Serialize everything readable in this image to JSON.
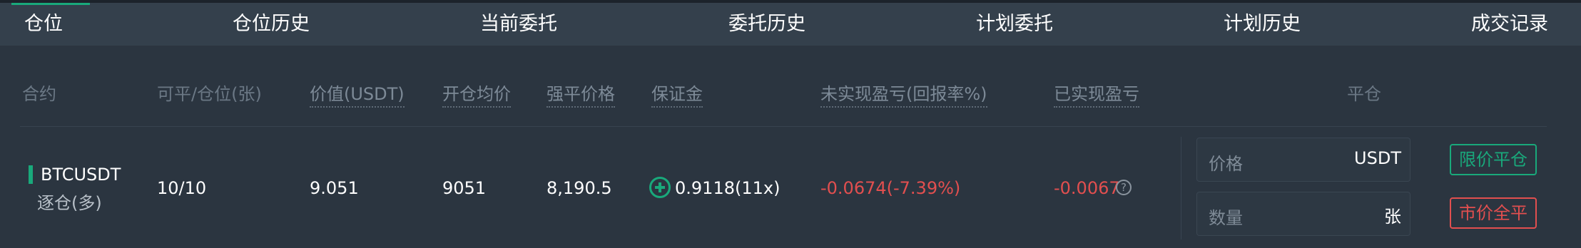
{
  "tabs": [
    {
      "label": "仓位"
    },
    {
      "label": "仓位历史"
    },
    {
      "label": "当前委托"
    },
    {
      "label": "委托历史"
    },
    {
      "label": "计划委托"
    },
    {
      "label": "计划历史"
    },
    {
      "label": "成交记录"
    }
  ],
  "columns": {
    "contract": "合约",
    "closable_position": "可平/仓位(张)",
    "value": "价值(USDT)",
    "avg_open_price": "开仓均价",
    "liq_price": "强平价格",
    "margin": "保证金",
    "unrealized_pnl": "未实现盈亏(回报率%)",
    "realized_pnl": "已实现盈亏",
    "close": "平仓"
  },
  "position": {
    "symbol": "BTCUSDT",
    "mode": "逐仓(多)",
    "closable_position": "10/10",
    "value": "9.051",
    "avg_open_price": "9051",
    "liq_price": "8,190.5",
    "margin": "0.9118(11x)",
    "unrealized_pnl": "-0.0674(-7.39%)",
    "realized_pnl": "-0.0067",
    "help_glyph": "?"
  },
  "close_panel": {
    "price_label": "价格",
    "price_unit": "USDT",
    "qty_label": "数量",
    "qty_unit": "张",
    "limit_close_button": "限价平仓",
    "market_close_button": "市价全平"
  },
  "colors": {
    "accent_green": "#19a97b",
    "loss_red": "#e24f4f"
  }
}
